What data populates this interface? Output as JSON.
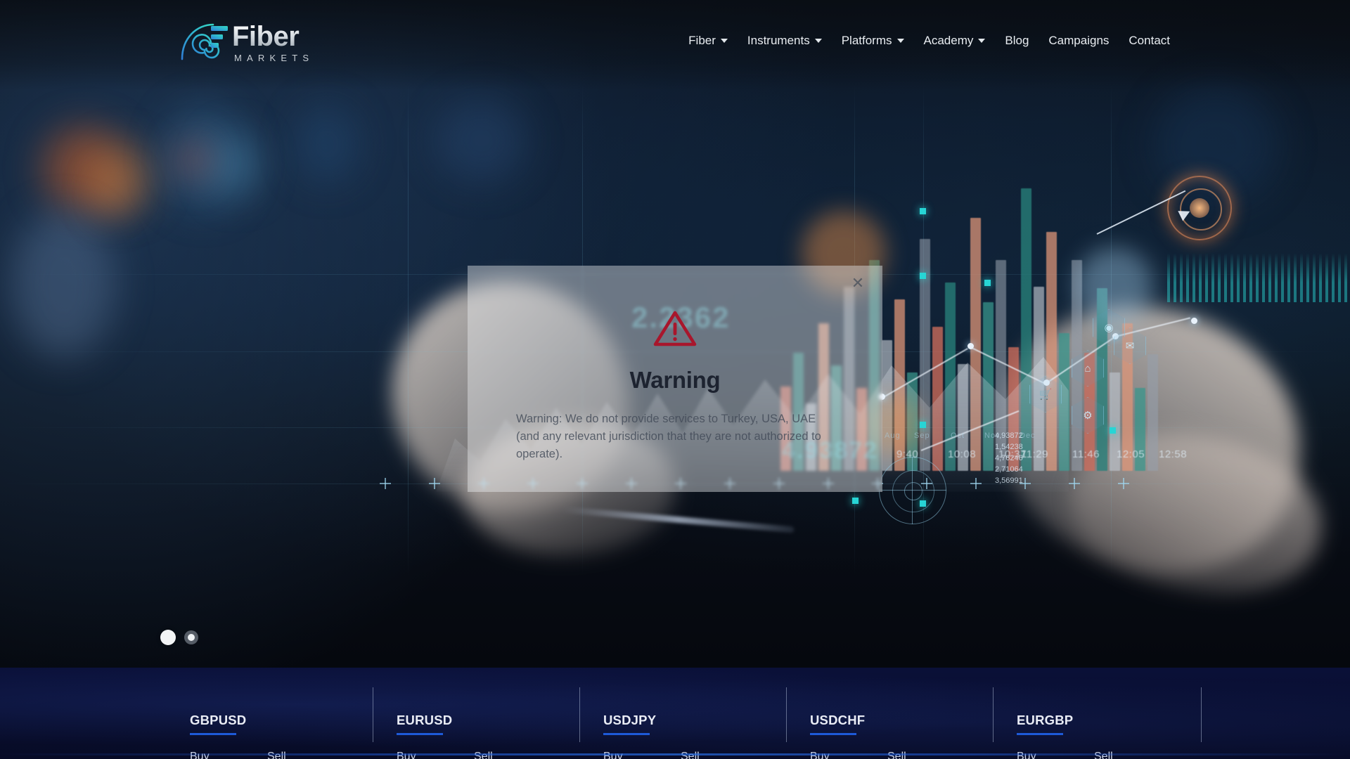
{
  "brand": {
    "name": "Fiber",
    "tagline": "MARKETS",
    "logo_icon": "spiral-nautilus-icon",
    "accent_start": "#2f7fd6",
    "accent_end": "#2fc6c6"
  },
  "nav": {
    "items": [
      {
        "label": "Fiber",
        "has_dropdown": true
      },
      {
        "label": "Instruments",
        "has_dropdown": true
      },
      {
        "label": "Platforms",
        "has_dropdown": true
      },
      {
        "label": "Academy",
        "has_dropdown": true
      },
      {
        "label": "Blog",
        "has_dropdown": false
      },
      {
        "label": "Campaigns",
        "has_dropdown": false
      },
      {
        "label": "Contact",
        "has_dropdown": false
      }
    ]
  },
  "hero": {
    "carousel": {
      "dots": [
        {
          "label": "Slide 1",
          "active": true
        },
        {
          "label": "Slide 2",
          "active": false
        }
      ]
    },
    "background_overlay": {
      "big_value_top": "2.2362",
      "big_value_bottom": "4.93872",
      "month_labels": [
        "Aug",
        "Sep",
        "Oct",
        "Nov",
        "Dec"
      ],
      "time_labels": [
        "9:40",
        "10:08",
        "10:37",
        "11:29",
        "11:46",
        "12:05",
        "12:58"
      ],
      "quote_values": [
        "4,93872",
        "1,54238",
        "4,76246",
        "2,71064",
        "3,56991"
      ],
      "hex_icons": [
        "globe-icon",
        "envelope-icon",
        "bank-icon",
        "cart-icon",
        "gear-icon"
      ]
    }
  },
  "modal": {
    "icon": "warning-triangle-icon",
    "icon_color": "#a8162c",
    "title": "Warning",
    "body": "Warning: We do not provide services to Turkey, USA, UAE (and any relevant jurisdiction that they are not authorized to operate).",
    "close_label": "✕",
    "close_icon": "close-icon"
  },
  "ticker": {
    "accent": "#1e5ad8",
    "buy_label": "Buy",
    "sell_label": "Sell",
    "pairs": [
      {
        "symbol": "GBPUSD"
      },
      {
        "symbol": "EURUSD"
      },
      {
        "symbol": "USDJPY"
      },
      {
        "symbol": "USDCHF"
      },
      {
        "symbol": "EURGBP"
      }
    ]
  }
}
